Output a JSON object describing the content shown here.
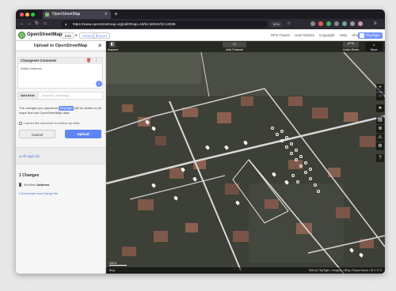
{
  "browser": {
    "tab_title": "OpenStreetMap",
    "url": "https://www.openstreetmap.org/edit#map=18/51.56042/10.12036",
    "zoom_level": "90%"
  },
  "osm_header": {
    "brand": "OpenStreetMap",
    "edit_label": "Edit",
    "history_label": "History",
    "export_label": "Export",
    "nav_links": [
      "GPS Traces",
      "User Diaries",
      "Copyright",
      "Help",
      "About"
    ],
    "user_label": "TinyTiger"
  },
  "sidebar": {
    "title": "Upload to OpenStreetMap",
    "changeset_label": "Changeset Comment",
    "changeset_value": "Added address",
    "changeset_count": "7",
    "hashtags_label": "Add field:",
    "hashtags_placeholder": "Sources, Hashtags",
    "note_pre": "The changes you upload as",
    "note_user": "TinyTiger",
    "note_post": "will be visible on all maps that use OpenStreetMap data.",
    "review_label": "I would like someone to review my edits.",
    "cancel_label": "Cancel",
    "upload_label": "Upload",
    "tags_label": "All tags (6)",
    "changes_title": "1 Changes",
    "change_item_name": "Modified",
    "change_item_type": "Address",
    "download_label": "Download osmChange file"
  },
  "map": {
    "inspect_label": "Inspect",
    "add_feature_label": "Add Feature",
    "undo_redo_label": "Undo Redo",
    "save_label": "Save",
    "save_count": "1",
    "scale_label": "100 ft",
    "attribution_left": "Bing",
    "attribution_right": "Edit by TinyTiger • Imagery • Bing • Report issue • iD 2.17.3"
  },
  "controls": [
    "zoom-in-icon",
    "zoom-out-icon",
    "locate-icon",
    "layers-icon",
    "map-data-icon",
    "issues-icon",
    "preferences-icon",
    "help-icon"
  ],
  "colors": {
    "accent": "#7092ff",
    "upload": "#5e85f5",
    "osm_green": "#7ebc6f"
  }
}
